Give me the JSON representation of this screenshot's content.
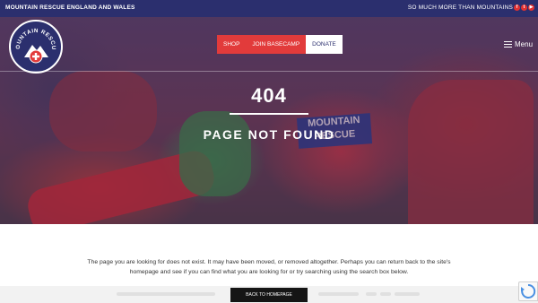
{
  "topbar": {
    "org_name": "MOUNTAIN RESCUE ENGLAND AND WALES",
    "tagline": "SO MUCH MORE THAN MOUNTAINS",
    "social": [
      {
        "icon": "facebook-icon",
        "glyph": "f"
      },
      {
        "icon": "twitter-icon",
        "glyph": "t"
      },
      {
        "icon": "youtube-icon",
        "glyph": "▶"
      }
    ]
  },
  "logo": {
    "text_top": "MOUNTAIN RESCUE",
    "icon": "mountain-cross-logo"
  },
  "nav": {
    "items": [
      {
        "label": "SHOP"
      },
      {
        "label": "JOIN BASECAMP"
      },
      {
        "label": "DONATE"
      }
    ],
    "menu_label": "Menu"
  },
  "hero": {
    "jacket_text": "MOUNTAIN RESCUE",
    "error_code": "404",
    "error_title": "PAGE NOT FOUND"
  },
  "content": {
    "message": "The page you are looking for does not exist. It may have been moved, or removed altogether. Perhaps you can return back to the site's homepage and see if you can find what you are looking for or try searching using the search box below.",
    "back_button": "BACK TO HOMEPAGE"
  },
  "colors": {
    "navy": "#2b2f6e",
    "accent_red": "#e23b3b",
    "white": "#ffffff"
  }
}
